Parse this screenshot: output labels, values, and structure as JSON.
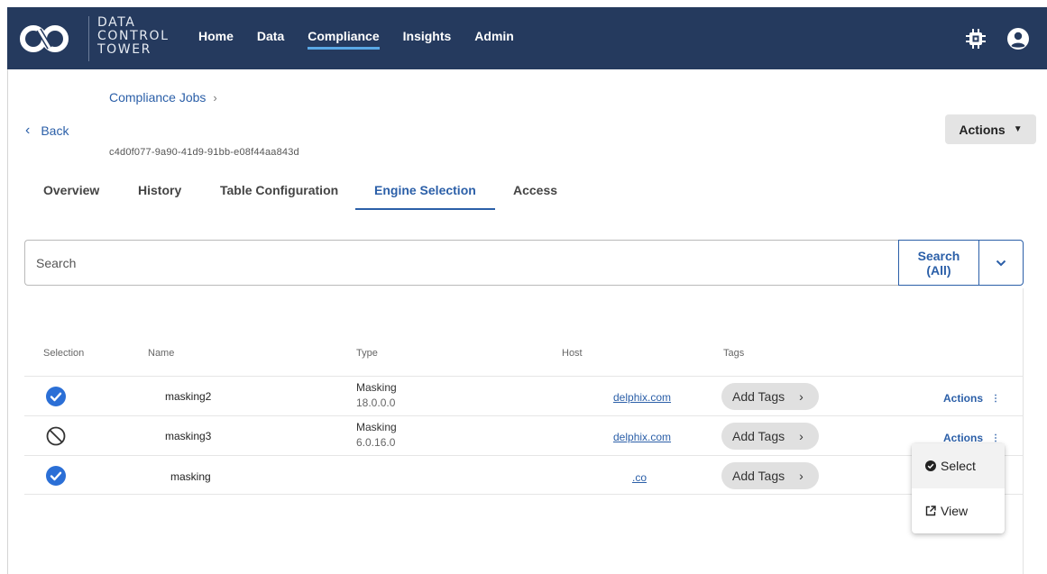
{
  "app": {
    "brand_lines": [
      "DATA",
      "CONTROL",
      "TOWER"
    ],
    "nav": [
      {
        "label": "Home"
      },
      {
        "label": "Data"
      },
      {
        "label": "Compliance",
        "active": true
      },
      {
        "label": "Insights"
      },
      {
        "label": "Admin"
      }
    ],
    "icons": {
      "logo": "delphix-logo",
      "chip": "chip-icon",
      "user": "user-circle-icon"
    },
    "colors": {
      "topbar": "#253a5e",
      "accent": "#2b5fa8",
      "nav_underline": "#5aa9e6",
      "selected": "#2b6fd6"
    }
  },
  "page": {
    "breadcrumb": {
      "label": "Compliance Jobs",
      "sep": "›"
    },
    "back_label": "Back",
    "job_id": "c4d0f077-9a90-41d9-91bb-e08f44aa843d",
    "actions_label": "Actions",
    "tabs": [
      {
        "label": "Overview"
      },
      {
        "label": "History"
      },
      {
        "label": "Table Configuration"
      },
      {
        "label": "Engine Selection",
        "active": true
      },
      {
        "label": "Access"
      }
    ]
  },
  "search": {
    "placeholder": "Search",
    "value": "",
    "scope_line1": "Search",
    "scope_line2": "(All)"
  },
  "table": {
    "columns": [
      "Selection",
      "Name",
      "Type",
      "Host",
      "Tags"
    ],
    "rows": [
      {
        "selected": true,
        "name": "masking2",
        "type": "Masking",
        "version": "18.0.0.0",
        "host": "delphix.com",
        "tags_label": "Add Tags",
        "actions_label": "Actions"
      },
      {
        "selected": false,
        "name": "masking3",
        "type": "Masking",
        "version": "6.0.16.0",
        "host": "delphix.com",
        "tags_label": "Add Tags",
        "actions_label": "Actions"
      },
      {
        "selected": true,
        "name": "masking",
        "type": "",
        "version": "",
        "host": ".co",
        "tags_label": "Add Tags",
        "actions_label": ""
      }
    ]
  },
  "context_menu": {
    "items": [
      {
        "label": "Select",
        "icon": "check-circle-icon"
      },
      {
        "label": "View",
        "icon": "external-link-icon"
      }
    ]
  }
}
